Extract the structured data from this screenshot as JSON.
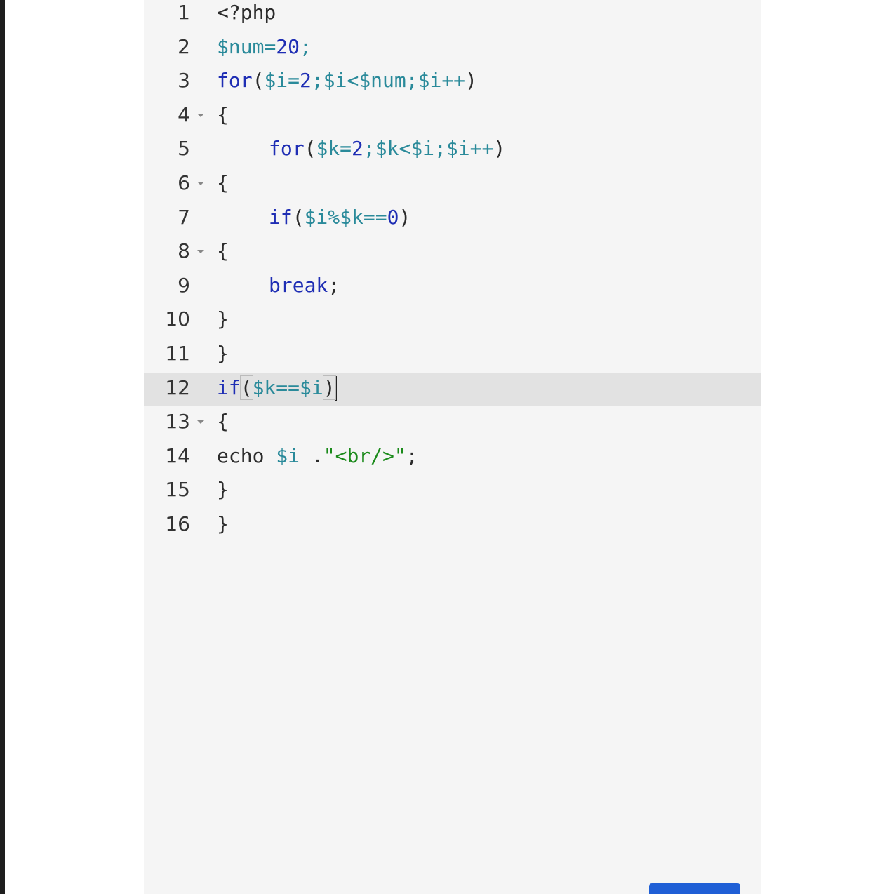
{
  "editor": {
    "lines": [
      {
        "num": "1",
        "tokens": [
          {
            "t": "<?php",
            "c": "plain"
          }
        ]
      },
      {
        "num": "2",
        "tokens": [
          {
            "t": "$num",
            "c": "var"
          },
          {
            "t": "=",
            "c": "var"
          },
          {
            "t": "20",
            "c": "num"
          },
          {
            "t": ";",
            "c": "var"
          }
        ]
      },
      {
        "num": "3",
        "tokens": [
          {
            "t": "for",
            "c": "kw"
          },
          {
            "t": "(",
            "c": "punc"
          },
          {
            "t": "$i",
            "c": "var"
          },
          {
            "t": "=",
            "c": "var"
          },
          {
            "t": "2",
            "c": "num"
          },
          {
            "t": ";",
            "c": "var"
          },
          {
            "t": "$i",
            "c": "var"
          },
          {
            "t": "<",
            "c": "var"
          },
          {
            "t": "$num",
            "c": "var"
          },
          {
            "t": ";",
            "c": "var"
          },
          {
            "t": "$i",
            "c": "var"
          },
          {
            "t": "++",
            "c": "var"
          },
          {
            "t": ")",
            "c": "punc"
          }
        ]
      },
      {
        "num": "4",
        "fold": true,
        "tokens": [
          {
            "t": "{",
            "c": "punc"
          }
        ]
      },
      {
        "num": "5",
        "indent": true,
        "tokens": [
          {
            "t": "for",
            "c": "kw"
          },
          {
            "t": "(",
            "c": "punc"
          },
          {
            "t": "$k",
            "c": "var"
          },
          {
            "t": "=",
            "c": "var"
          },
          {
            "t": "2",
            "c": "num"
          },
          {
            "t": ";",
            "c": "var"
          },
          {
            "t": "$k",
            "c": "var"
          },
          {
            "t": "<",
            "c": "var"
          },
          {
            "t": "$i",
            "c": "var"
          },
          {
            "t": ";",
            "c": "var"
          },
          {
            "t": "$i",
            "c": "var"
          },
          {
            "t": "++",
            "c": "var"
          },
          {
            "t": ")",
            "c": "punc"
          }
        ]
      },
      {
        "num": "6",
        "fold": true,
        "tokens": [
          {
            "t": "{",
            "c": "punc"
          }
        ]
      },
      {
        "num": "7",
        "indent": true,
        "tokens": [
          {
            "t": "if",
            "c": "kw"
          },
          {
            "t": "(",
            "c": "punc"
          },
          {
            "t": "$i",
            "c": "var"
          },
          {
            "t": "%",
            "c": "var"
          },
          {
            "t": "$k",
            "c": "var"
          },
          {
            "t": "==",
            "c": "var"
          },
          {
            "t": "0",
            "c": "num"
          },
          {
            "t": ")",
            "c": "punc"
          }
        ]
      },
      {
        "num": "8",
        "fold": true,
        "tokens": [
          {
            "t": "{",
            "c": "punc"
          }
        ]
      },
      {
        "num": "9",
        "indent": true,
        "tokens": [
          {
            "t": "break",
            "c": "kw"
          },
          {
            "t": ";",
            "c": "punc"
          }
        ]
      },
      {
        "num": "10",
        "tokens": [
          {
            "t": "}",
            "c": "punc"
          }
        ]
      },
      {
        "num": "11",
        "tokens": [
          {
            "t": "}",
            "c": "punc"
          }
        ]
      },
      {
        "num": "12",
        "active": true,
        "tokens": [
          {
            "t": "if",
            "c": "kw"
          },
          {
            "t": "(",
            "c": "bracket-match"
          },
          {
            "t": "$k",
            "c": "var"
          },
          {
            "t": "==",
            "c": "var"
          },
          {
            "t": "$i",
            "c": "var"
          },
          {
            "t": ")",
            "c": "bracket-match"
          }
        ],
        "cursor": true
      },
      {
        "num": "13",
        "fold": true,
        "tokens": [
          {
            "t": "{",
            "c": "punc"
          }
        ]
      },
      {
        "num": "14",
        "tokens": [
          {
            "t": "echo ",
            "c": "plain"
          },
          {
            "t": "$i",
            "c": "var"
          },
          {
            "t": " .",
            "c": "plain"
          },
          {
            "t": "\"<br/>\"",
            "c": "str"
          },
          {
            "t": ";",
            "c": "punc"
          }
        ]
      },
      {
        "num": "15",
        "tokens": [
          {
            "t": "}",
            "c": "punc"
          }
        ]
      },
      {
        "num": "16",
        "tokens": [
          {
            "t": "}",
            "c": "punc"
          }
        ]
      }
    ]
  },
  "colors": {
    "keyword": "#1f2eb4",
    "variable": "#2a8a9a",
    "string": "#1a8a1a",
    "active_line": "#e2e2e2",
    "editor_bg": "#f5f5f5",
    "button": "#1f5fd6"
  }
}
